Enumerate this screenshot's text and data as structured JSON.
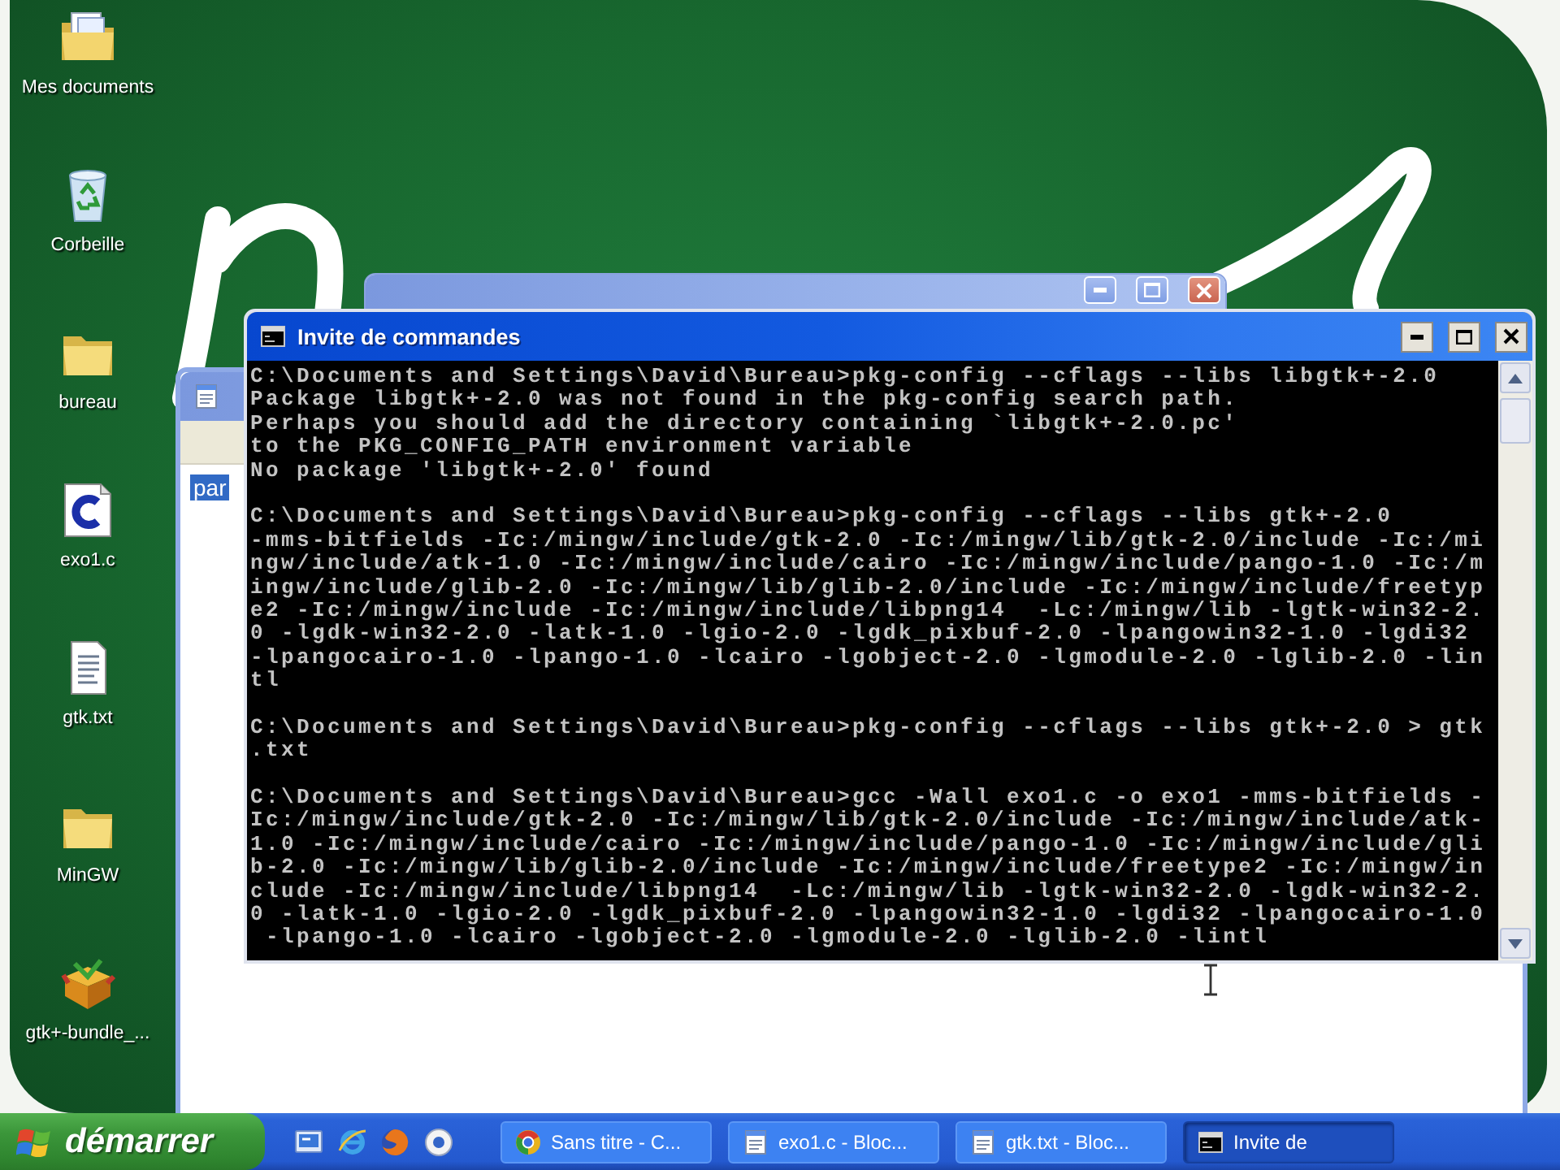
{
  "desktop_icons": [
    {
      "label": "Mes documents",
      "kind": "documents"
    },
    {
      "label": "Corbeille",
      "kind": "recycle"
    },
    {
      "label": "bureau",
      "kind": "folder"
    },
    {
      "label": "exo1.c",
      "kind": "c_source"
    },
    {
      "label": "gtk.txt",
      "kind": "text"
    },
    {
      "label": "MinGW",
      "kind": "folder"
    },
    {
      "label": "gtk+-bundle_...",
      "kind": "package"
    }
  ],
  "windows": {
    "back_window": {
      "active": false
    },
    "notepad": {
      "active": false,
      "selected_text": "par"
    },
    "console": {
      "title": "Invite de commandes",
      "active": true,
      "blocks": [
        {
          "lines": [
            "C:\\Documents and Settings\\David\\Bureau>pkg-config --cflags --libs libgtk+-2.0",
            "Package libgtk+-2.0 was not found in the pkg-config search path.",
            "Perhaps you should add the directory containing `libgtk+-2.0.pc'",
            "to the PKG_CONFIG_PATH environment variable",
            "No package 'libgtk+-2.0' found"
          ]
        },
        {
          "lines": [
            "C:\\Documents and Settings\\David\\Bureau>pkg-config --cflags --libs gtk+-2.0",
            "-mms-bitfields -Ic:/mingw/include/gtk-2.0 -Ic:/mingw/lib/gtk-2.0/include -Ic:/mi",
            "ngw/include/atk-1.0 -Ic:/mingw/include/cairo -Ic:/mingw/include/pango-1.0 -Ic:/m",
            "ingw/include/glib-2.0 -Ic:/mingw/lib/glib-2.0/include -Ic:/mingw/include/freetyp",
            "e2 -Ic:/mingw/include -Ic:/mingw/include/libpng14  -Lc:/mingw/lib -lgtk-win32-2.",
            "0 -lgdk-win32-2.0 -latk-1.0 -lgio-2.0 -lgdk_pixbuf-2.0 -lpangowin32-1.0 -lgdi32",
            "-lpangocairo-1.0 -lpango-1.0 -lcairo -lgobject-2.0 -lgmodule-2.0 -lglib-2.0 -lin",
            "tl"
          ]
        },
        {
          "lines": [
            "C:\\Documents and Settings\\David\\Bureau>pkg-config --cflags --libs gtk+-2.0 > gtk",
            ".txt"
          ]
        },
        {
          "lines": [
            "C:\\Documents and Settings\\David\\Bureau>gcc -Wall exo1.c -o exo1 -mms-bitfields -",
            "Ic:/mingw/include/gtk-2.0 -Ic:/mingw/lib/gtk-2.0/include -Ic:/mingw/include/atk-",
            "1.0 -Ic:/mingw/include/cairo -Ic:/mingw/include/pango-1.0 -Ic:/mingw/include/gli",
            "b-2.0 -Ic:/mingw/lib/glib-2.0/include -Ic:/mingw/include/freetype2 -Ic:/mingw/in",
            "clude -Ic:/mingw/include/libpng14  -Lc:/mingw/lib -lgtk-win32-2.0 -lgdk-win32-2.",
            "0 -latk-1.0 -lgio-2.0 -lgdk_pixbuf-2.0 -lpangowin32-1.0 -lgdi32 -lpangocairo-1.0",
            " -lpango-1.0 -lcairo -lgobject-2.0 -lgmodule-2.0 -lglib-2.0 -lintl"
          ]
        }
      ]
    }
  },
  "taskbar": {
    "start_label": "démarrer",
    "quick_launch": [
      {
        "kind": "desktop"
      },
      {
        "kind": "web"
      },
      {
        "kind": "fox"
      },
      {
        "kind": "disc"
      }
    ],
    "tasks": [
      {
        "label": "Sans titre - C...",
        "kind": "browser",
        "selected": false
      },
      {
        "label": "exo1.c - Bloc...",
        "kind": "notepad",
        "selected": false
      },
      {
        "label": "gtk.txt - Bloc...",
        "kind": "notepad",
        "selected": false
      },
      {
        "label": "Invite de",
        "kind": "console",
        "selected": true
      }
    ]
  }
}
